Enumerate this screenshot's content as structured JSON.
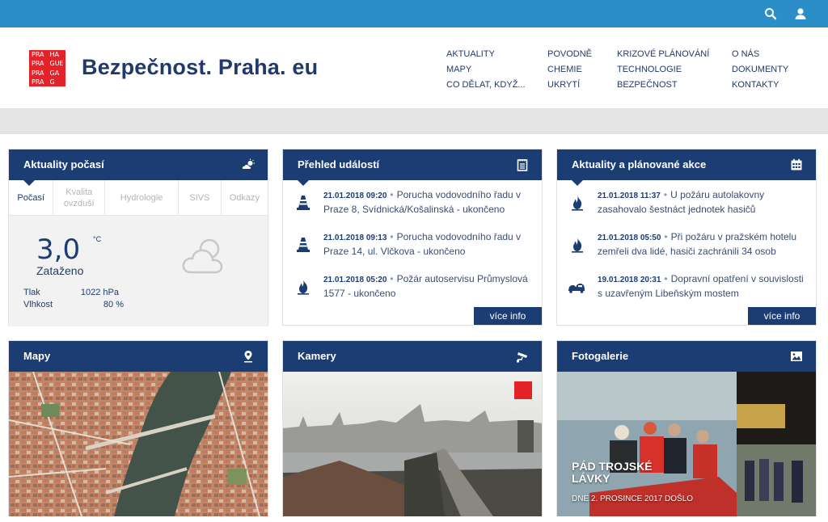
{
  "site": {
    "title": "Bezpečnost. Praha. eu",
    "logo_lines": [
      "PRA",
      "HA",
      "PRA",
      "GUE",
      "PRA",
      "GA",
      "PRA",
      "G"
    ]
  },
  "topbar": {
    "icons": [
      "search-icon",
      "user-icon"
    ]
  },
  "nav": {
    "columns": [
      [
        "Aktuality",
        "Mapy",
        "Co dělat, když..."
      ],
      [
        "Povodně",
        "Chemie",
        "Ukrytí"
      ],
      [
        "Krizové plánování",
        "Technologie",
        "Bezpečnost"
      ],
      [
        "O nás",
        "Dokumenty",
        "Kontakty"
      ]
    ]
  },
  "weather": {
    "title": "Aktuality počasí",
    "tabs": [
      "Počasí",
      "Kvalita ovzduší",
      "Hydrologie",
      "SIVS",
      "Odkazy"
    ],
    "temperature": "3,0",
    "unit": "°C",
    "condition": "Zataženo",
    "pressure_label": "Tlak",
    "pressure_value": "1022 hPa",
    "humidity_label": "Vlhkost",
    "humidity_value": "80 %"
  },
  "events": {
    "title": "Přehled událostí",
    "more": "více info",
    "items": [
      {
        "time": "21.01.2018 09:20",
        "text": "Porucha vodovodního řadu v Praze 8, Svídnická/Košalinská - ukončeno",
        "icon": "traffic-cone-icon"
      },
      {
        "time": "21.01.2018 09:13",
        "text": "Porucha vodovodního řadu v Praze 14, ul. Vlčkova - ukončeno",
        "icon": "traffic-cone-icon"
      },
      {
        "time": "21.01.2018 05:20",
        "text": "Požár autoservisu Průmyslová 1577 - ukončeno",
        "icon": "fire-icon"
      }
    ]
  },
  "actions": {
    "title": "Aktuality a plánované akce",
    "more": "více info",
    "items": [
      {
        "time": "21.01.2018 11:37",
        "text": "U požáru autolakovny zasahovalo šestnáct jednotek hasičů",
        "icon": "fire-icon"
      },
      {
        "time": "21.01.2018 05:50",
        "text": "Při požáru v pražském hotelu zemřeli dva lidé, hasiči zachránili 34 osob",
        "icon": "fire-icon"
      },
      {
        "time": "19.01.2018 20:31",
        "text": "Dopravní opatření v souvislosti s uzavřeným Libeňským mostem",
        "icon": "car-crash-icon"
      }
    ]
  },
  "maps": {
    "title": "Mapy"
  },
  "cameras": {
    "title": "Kamery"
  },
  "gallery": {
    "title": "Fotogalerie",
    "photo_title": "Pád Trojské lávky",
    "photo_subtitle": "Dne 2. prosince 2017 došlo"
  },
  "colors": {
    "topbar": "#2c8ec6",
    "header_blue": "#1c3d73",
    "logo_red": "#e3222a",
    "strip_grey": "#e4e4e4"
  }
}
